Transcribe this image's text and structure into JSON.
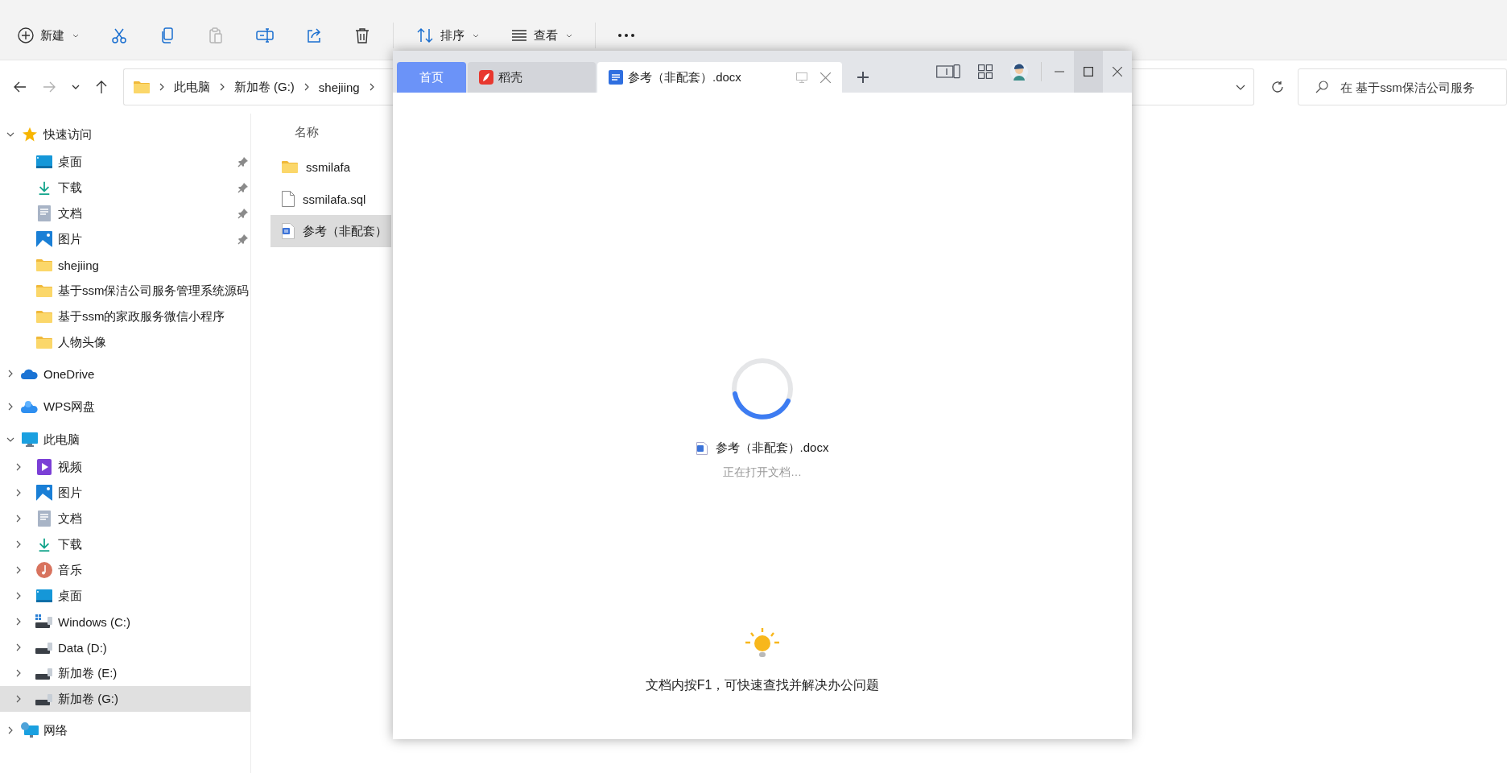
{
  "explorer": {
    "toolbar": [
      {
        "kind": "new",
        "label": "新建",
        "dropdown": true,
        "disabled": false
      },
      {
        "kind": "cut",
        "disabled": false
      },
      {
        "kind": "copy",
        "disabled": false
      },
      {
        "kind": "paste",
        "disabled": true
      },
      {
        "kind": "rename",
        "disabled": false
      },
      {
        "kind": "share",
        "disabled": false
      },
      {
        "kind": "delete",
        "disabled": false
      },
      {
        "kind": "separator"
      },
      {
        "kind": "sort",
        "label": "排序",
        "dropdown": true,
        "disabled": false
      },
      {
        "kind": "view",
        "label": "查看",
        "dropdown": true,
        "disabled": false
      },
      {
        "kind": "separator"
      },
      {
        "kind": "more",
        "disabled": false
      }
    ],
    "nav": [
      {
        "kind": "back",
        "disabled": false
      },
      {
        "kind": "forward",
        "disabled": true
      },
      {
        "kind": "recent",
        "disabled": false
      },
      {
        "kind": "up",
        "disabled": false
      }
    ],
    "breadcrumb": [
      "此电脑",
      "新加卷 (G:)",
      "shejiing"
    ],
    "search": {
      "placeholder": "在 基于ssm保洁公司服务"
    },
    "sidebar": [
      {
        "label": "快速访问",
        "kind": "star",
        "expanded": true,
        "selected": false,
        "children": [
          {
            "label": "桌面",
            "kind": "desktop",
            "pinned": true,
            "selected": false
          },
          {
            "label": "下载",
            "kind": "download",
            "pinned": true,
            "selected": false
          },
          {
            "label": "文档",
            "kind": "documents",
            "pinned": true,
            "selected": false
          },
          {
            "label": "图片",
            "kind": "pictures",
            "pinned": true,
            "selected": false
          },
          {
            "label": "shejiing",
            "kind": "folder",
            "pinned": false,
            "selected": false
          },
          {
            "label": "基于ssm保洁公司服务管理系统源码",
            "kind": "folder",
            "pinned": false,
            "selected": false
          },
          {
            "label": "基于ssm的家政服务微信小程序",
            "kind": "folder",
            "pinned": false,
            "selected": false
          },
          {
            "label": "人物头像",
            "kind": "folder",
            "pinned": false,
            "selected": false
          }
        ]
      },
      {
        "label": "OneDrive",
        "kind": "cloud",
        "expanded": false,
        "selected": false
      },
      {
        "label": "WPS网盘",
        "kind": "cloud2",
        "expanded": false,
        "selected": false
      },
      {
        "label": "此电脑",
        "kind": "pc",
        "expanded": true,
        "selected": false,
        "children": [
          {
            "label": "视频",
            "kind": "video",
            "expanded": false,
            "selected": false
          },
          {
            "label": "图片",
            "kind": "pictures",
            "expanded": false,
            "selected": false
          },
          {
            "label": "文档",
            "kind": "documents",
            "expanded": false,
            "selected": false
          },
          {
            "label": "下载",
            "kind": "download",
            "expanded": false,
            "selected": false
          },
          {
            "label": "音乐",
            "kind": "music",
            "expanded": false,
            "selected": false
          },
          {
            "label": "桌面",
            "kind": "desktop",
            "expanded": false,
            "selected": false
          },
          {
            "label": "Windows (C:)",
            "kind": "windrive",
            "expanded": false,
            "selected": false
          },
          {
            "label": "Data (D:)",
            "kind": "drive",
            "expanded": false,
            "selected": false
          },
          {
            "label": "新加卷 (E:)",
            "kind": "drive",
            "expanded": false,
            "selected": false
          },
          {
            "label": "新加卷 (G:)",
            "kind": "drive",
            "expanded": false,
            "selected": true
          }
        ]
      },
      {
        "label": "网络",
        "kind": "network",
        "expanded": false,
        "selected": false
      }
    ],
    "file_list": {
      "columns": [
        "名称"
      ],
      "rows": [
        {
          "name": "ssmilafa",
          "kind": "folder",
          "selected": false
        },
        {
          "name": "ssmilafa.sql",
          "kind": "file",
          "selected": false
        },
        {
          "name": "参考（非配套）",
          "kind": "word",
          "selected": true
        }
      ]
    }
  },
  "wps": {
    "tabs": [
      {
        "label": "首页",
        "kind": "home",
        "selected": false
      },
      {
        "label": "稻壳",
        "kind": "docer",
        "selected": false
      },
      {
        "label": "参考（非配套）.docx",
        "kind": "document",
        "selected": true
      }
    ],
    "window_controls": [
      {
        "kind": "minimize",
        "hovered": false
      },
      {
        "kind": "maximize",
        "hovered": true
      },
      {
        "kind": "close",
        "hovered": false
      }
    ],
    "loading": {
      "file_name": "参考（非配套）.docx",
      "status": "正在打开文档…"
    },
    "tip": "文档内按F1，可快速查找并解决办公问题"
  }
}
